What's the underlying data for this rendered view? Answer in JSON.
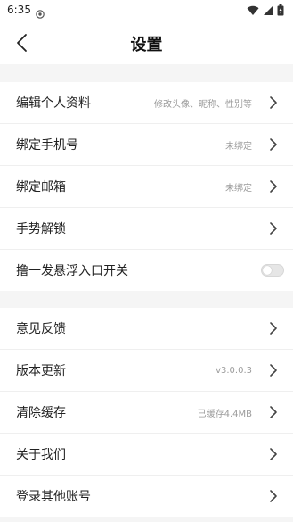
{
  "status_bar": {
    "time": "6:35"
  },
  "header": {
    "title": "设置"
  },
  "section1": [
    {
      "label": "编辑个人资料",
      "value": "修改头像、昵称、性别等"
    },
    {
      "label": "绑定手机号",
      "value": "未绑定"
    },
    {
      "label": "绑定邮箱",
      "value": "未绑定"
    },
    {
      "label": "手势解锁",
      "value": ""
    },
    {
      "label": "撸一发悬浮入口开关",
      "toggle": false
    }
  ],
  "section2": [
    {
      "label": "意见反馈",
      "value": ""
    },
    {
      "label": "版本更新",
      "value": "v3.0.0.3"
    },
    {
      "label": "清除缓存",
      "value": "已缓存4.4MB"
    },
    {
      "label": "关于我们",
      "value": ""
    },
    {
      "label": "登录其他账号",
      "value": ""
    }
  ]
}
